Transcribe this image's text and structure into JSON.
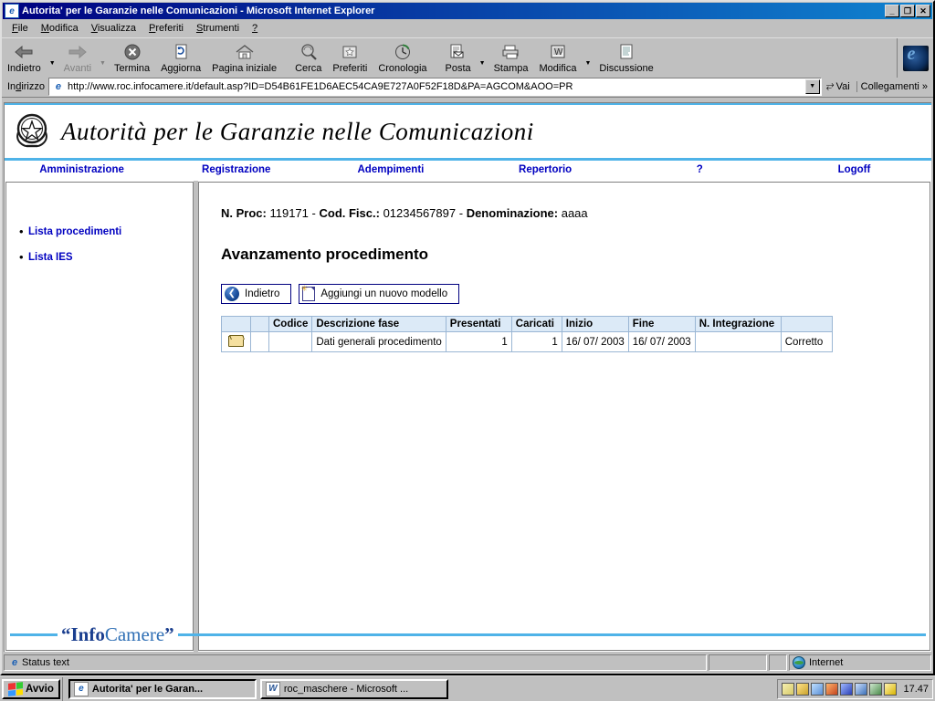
{
  "window": {
    "title": "Autorita' per le Garanzie nelle Comunicazioni - Microsoft Internet Explorer",
    "title_icon": "ie-document-icon",
    "minimize": "_",
    "maximize": "❐",
    "close": "✕"
  },
  "menu": [
    {
      "label": "File",
      "accel": "F"
    },
    {
      "label": "Modifica",
      "accel": "M"
    },
    {
      "label": "Visualizza",
      "accel": "V"
    },
    {
      "label": "Preferiti",
      "accel": "P"
    },
    {
      "label": "Strumenti",
      "accel": "S"
    },
    {
      "label": "?",
      "accel": "?"
    }
  ],
  "toolbar": {
    "buttons": [
      {
        "label": "Indietro",
        "icon": "back-arrow-icon",
        "disabled": false,
        "dropdown": true
      },
      {
        "label": "Avanti",
        "icon": "forward-arrow-icon",
        "disabled": true,
        "dropdown": true
      },
      {
        "label": "Termina",
        "icon": "stop-icon",
        "disabled": false,
        "dropdown": false
      },
      {
        "label": "Aggiorna",
        "icon": "refresh-icon",
        "disabled": false,
        "dropdown": false
      },
      {
        "label": "Pagina iniziale",
        "icon": "home-icon",
        "disabled": false,
        "dropdown": false
      },
      {
        "label": "Cerca",
        "icon": "search-icon",
        "disabled": false,
        "dropdown": false
      },
      {
        "label": "Preferiti",
        "icon": "favorites-icon",
        "disabled": false,
        "dropdown": false
      },
      {
        "label": "Cronologia",
        "icon": "history-icon",
        "disabled": false,
        "dropdown": false
      },
      {
        "label": "Posta",
        "icon": "mail-icon",
        "disabled": false,
        "dropdown": true
      },
      {
        "label": "Stampa",
        "icon": "print-icon",
        "disabled": false,
        "dropdown": false
      },
      {
        "label": "Modifica",
        "icon": "edit-icon",
        "disabled": false,
        "dropdown": true
      },
      {
        "label": "Discussione",
        "icon": "discussion-icon",
        "disabled": false,
        "dropdown": false
      }
    ]
  },
  "address": {
    "label": "Indirizzo",
    "url": "http://www.roc.infocamere.it/default.asp?ID=D54B61FE1D6AEC54CA9E727A0F52F18D&PA=AGCOM&AOO=PR",
    "go_label": "Vai",
    "links_label": "Collegamenti",
    "links_chevron": "»",
    "dropdown_icon": "chevron-down-icon"
  },
  "page": {
    "banner_title": "Autorità per le Garanzie nelle Comunicazioni",
    "crest_icon": "italian-republic-emblem",
    "nav": [
      {
        "label": "Amministrazione"
      },
      {
        "label": "Registrazione"
      },
      {
        "label": "Adempimenti"
      },
      {
        "label": "Repertorio"
      },
      {
        "label": "?"
      },
      {
        "label": "Logoff"
      }
    ],
    "sidebar": {
      "items": [
        {
          "label": "Lista procedimenti"
        },
        {
          "label": "Lista IES"
        }
      ]
    },
    "header_fields": [
      {
        "label": "N. Proc:",
        "value": "119171"
      },
      {
        "label": "Cod. Fisc.:",
        "value": "01234567897"
      },
      {
        "label": "Denominazione:",
        "value": "aaaa"
      }
    ],
    "header_separator": "-",
    "title": "Avanzamento procedimento",
    "buttons": [
      {
        "label": "Indietro",
        "icon": "back-circle-icon"
      },
      {
        "label": "Aggiungi un nuovo modello",
        "icon": "new-document-icon"
      }
    ],
    "table": {
      "columns": [
        "",
        "",
        "Codice",
        "Descrizione fase",
        "Presentati",
        "Caricati",
        "Inizio",
        "Fine",
        "N. Integrazione",
        ""
      ],
      "rows": [
        {
          "icon": "open-folder-icon",
          "flag": "",
          "codice": "",
          "descrizione": "Dati generali procedimento",
          "presentati": "1",
          "caricati": "1",
          "inizio": "16/ 07/ 2003",
          "fine": "16/ 07/ 2003",
          "integrazione": "",
          "stato": "Corretto"
        }
      ]
    },
    "footer_logo_quote_open": "“",
    "footer_logo_info": "Info",
    "footer_logo_camere": "Camere",
    "footer_logo_quote_close": "”"
  },
  "statusbar": {
    "text": "Status text",
    "zone": "Internet",
    "zone_icon": "globe-icon",
    "page_icon": "ie-page-icon"
  },
  "taskbar": {
    "start_label": "Avvio",
    "start_icon": "windows-flag-icon",
    "tasks": [
      {
        "label": "Autorita' per le Garan...",
        "icon": "ie-icon",
        "active": true
      },
      {
        "label": "roc_maschere - Microsoft ...",
        "icon": "word-icon",
        "active": false
      }
    ],
    "tray_icons": [
      "volume-icon",
      "pencil-icon",
      "display-icon",
      "monitor-icon",
      "funnel-icon",
      "tools-icon",
      "security-icon",
      "lightbulb-icon"
    ],
    "clock": "17.47"
  },
  "colors": {
    "title_bar": "#000080",
    "chrome": "#c0c0c0",
    "link": "#0000c0",
    "accent_blue": "#4fb3e8",
    "table_header": "#dceaf7",
    "table_border": "#9ab6d4",
    "desktop": "#008080"
  }
}
